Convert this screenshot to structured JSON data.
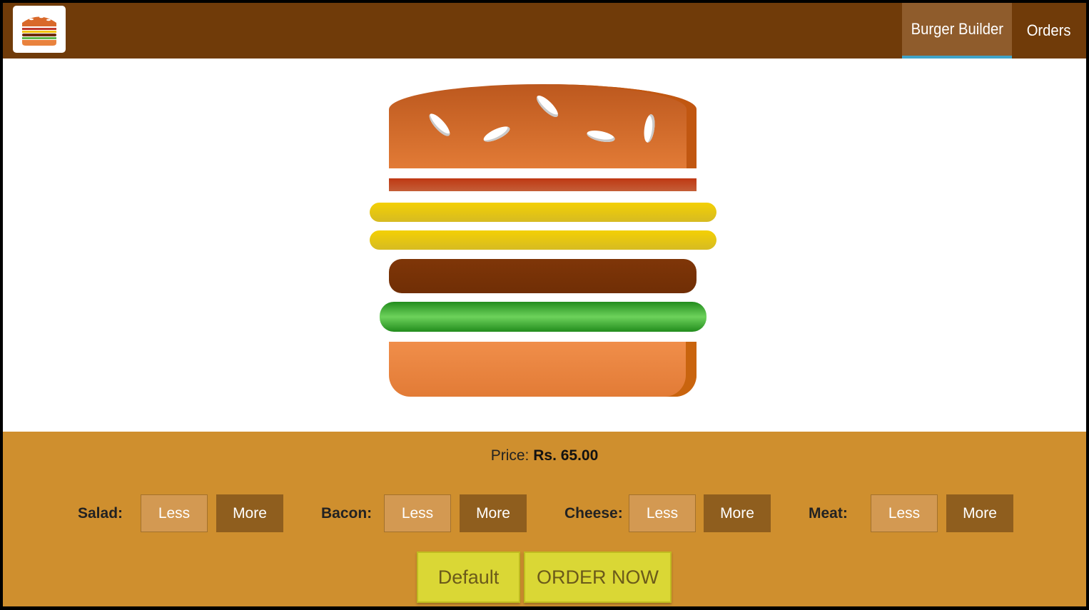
{
  "nav": {
    "items": [
      {
        "label": "Burger Builder",
        "active": true
      },
      {
        "label": "Orders",
        "active": false
      }
    ]
  },
  "price": {
    "label": "Price:",
    "value": "Rs. 65.00"
  },
  "ingredients": [
    {
      "label": "Salad:",
      "less": "Less",
      "more": "More"
    },
    {
      "label": "Bacon:",
      "less": "Less",
      "more": "More"
    },
    {
      "label": "Cheese:",
      "less": "Less",
      "more": "More"
    },
    {
      "label": "Meat:",
      "less": "Less",
      "more": "More"
    }
  ],
  "actions": {
    "default_label": "Default",
    "order_label": "ORDER NOW"
  },
  "burger": {
    "layers": [
      "bacon",
      "cheese",
      "cheese",
      "meat",
      "salad"
    ]
  },
  "colors": {
    "toolbar": "#703b09",
    "nav_active_bg": "#8f5c2c",
    "nav_active_underline": "#40a4c8",
    "controls_bg": "#cf8f2e",
    "less_button": "#d39952",
    "more_button": "#8f5e1e",
    "action_button": "#dad735"
  }
}
